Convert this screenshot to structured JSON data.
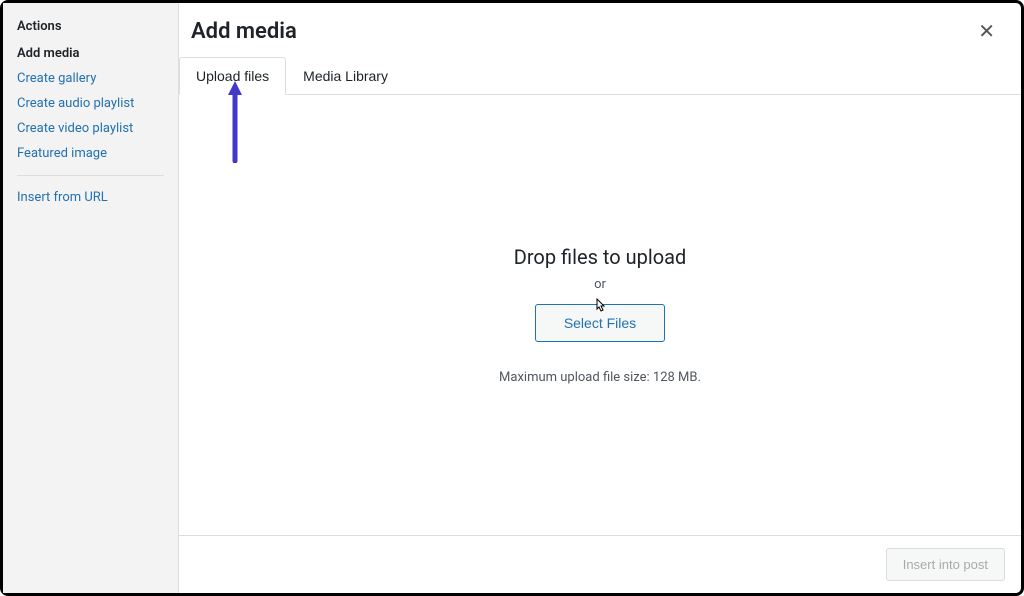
{
  "sidebar": {
    "heading": "Actions",
    "addMedia": "Add media",
    "links": [
      "Create gallery",
      "Create audio playlist",
      "Create video playlist",
      "Featured image"
    ],
    "insertFromUrl": "Insert from URL"
  },
  "header": {
    "title": "Add media"
  },
  "tabs": {
    "uploadFiles": "Upload files",
    "mediaLibrary": "Media Library"
  },
  "content": {
    "dropTitle": "Drop files to upload",
    "or": "or",
    "selectButton": "Select Files",
    "maxSize": "Maximum upload file size: 128 MB."
  },
  "footer": {
    "insertButton": "Insert into post"
  }
}
